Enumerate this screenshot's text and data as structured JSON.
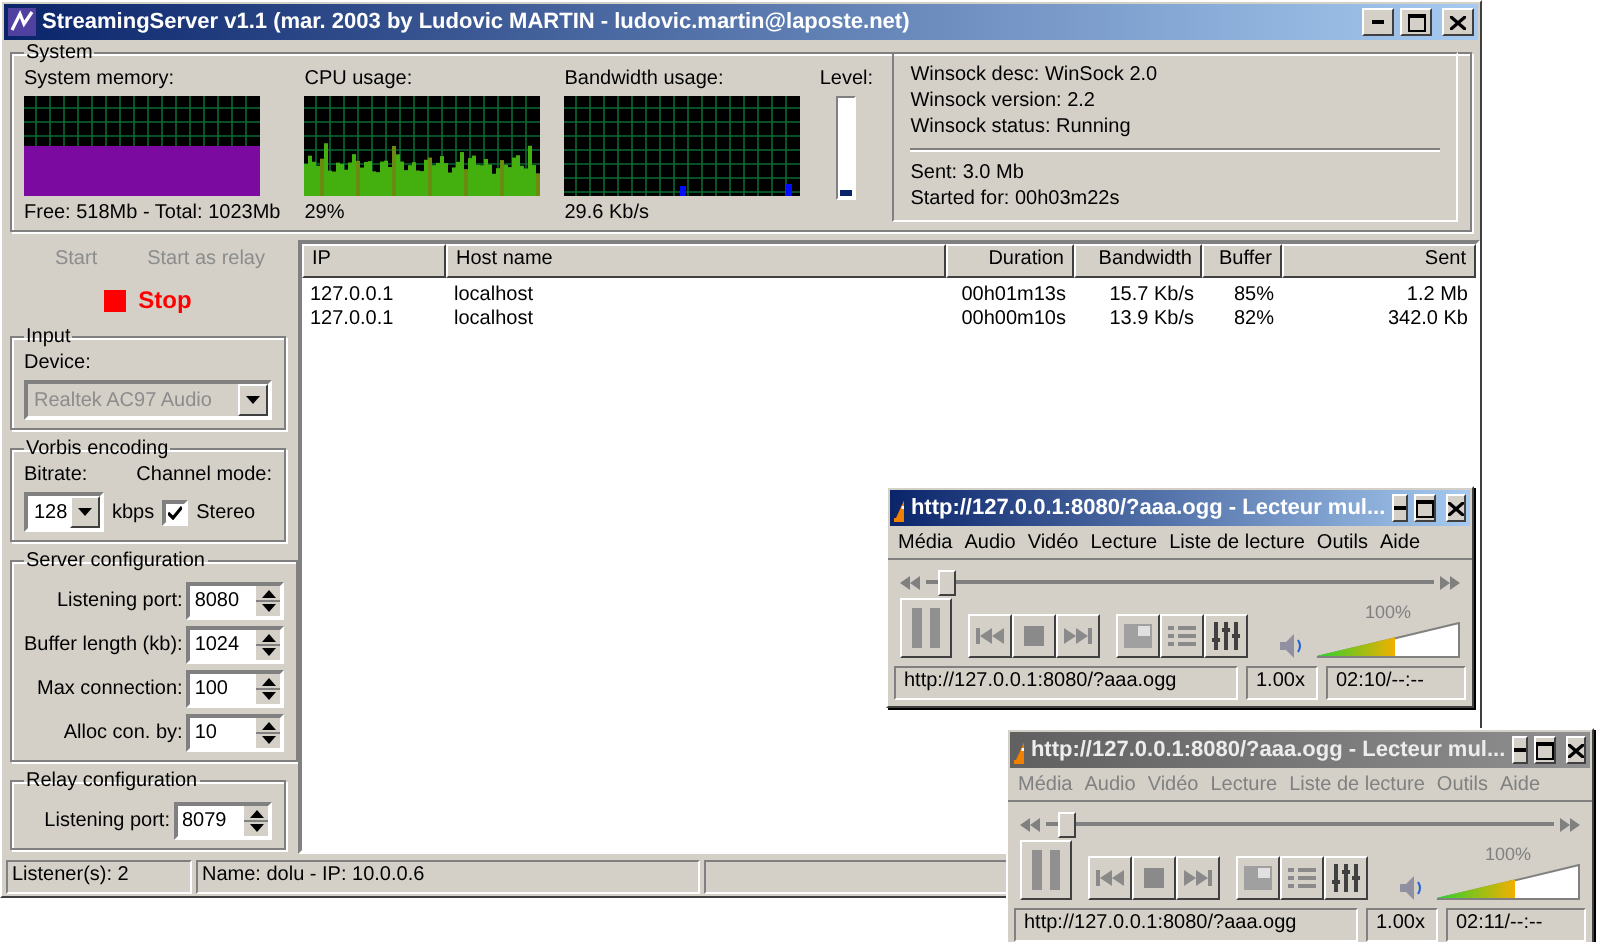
{
  "window": {
    "title": "StreamingServer v1.1 (mar. 2003 by Ludovic MARTIN - ludovic.martin@laposte.net)"
  },
  "system": {
    "title": "System",
    "graphs": [
      {
        "kind": "memory",
        "label": "System memory:",
        "reading": "Free: 518Mb - Total: 1023Mb"
      },
      {
        "kind": "cpu",
        "label": "CPU usage:",
        "reading": "29%"
      },
      {
        "kind": "bandwidth",
        "label": "Bandwidth usage:",
        "reading": "29.6 Kb/s"
      }
    ],
    "meter": {
      "label": "Level:",
      "level": 0.05
    },
    "info": [
      "Winsock desc: WinSock 2.0",
      "Winsock version: 2.2",
      "Winsock status: Running"
    ],
    "stats": [
      "Sent: 3.0 Mb",
      "Started for: 00h03m22s"
    ]
  },
  "start_buttons": [
    {
      "label": "Start",
      "disabled": true
    },
    {
      "label": "Start as relay",
      "disabled": true
    }
  ],
  "stop": {
    "label": "Stop",
    "disabled": false
  },
  "input": {
    "title": "Input",
    "device_label": "Device:",
    "device": "Realtek AC97 Audio",
    "disabled": true
  },
  "encoding": {
    "title": "Vorbis encoding",
    "bitrate_label": "Bitrate:",
    "bitrate": "128",
    "unit": "kbps",
    "channel_label": "Channel mode:",
    "stereo": {
      "label": "Stereo",
      "checked": true
    }
  },
  "server": {
    "title": "Server configuration",
    "fields": [
      {
        "label": "Listening port:",
        "value": "8080"
      },
      {
        "label": "Buffer length (kb):",
        "value": "1024"
      },
      {
        "label": "Max connection:",
        "value": "100"
      },
      {
        "label": "Alloc con. by:",
        "value": "10"
      }
    ]
  },
  "relay": {
    "title": "Relay configuration",
    "fields": [
      {
        "label": "Listening port:",
        "value": "8079"
      }
    ]
  },
  "table": {
    "columns": [
      "IP",
      "Host name",
      "Duration",
      "Bandwidth",
      "Buffer",
      "Sent"
    ],
    "rows": [
      [
        "127.0.0.1",
        "localhost",
        "00h01m13s",
        "15.7 Kb/s",
        "85%",
        "1.2 Mb"
      ],
      [
        "127.0.0.1",
        "localhost",
        "00h00m10s",
        "13.9 Kb/s",
        "82%",
        "342.0 Kb"
      ]
    ]
  },
  "status_bar": [
    "Listener(s): 2",
    "Name: dolu - IP: 10.0.0.6"
  ],
  "players": [
    {
      "title": "http://127.0.0.1:8080/?aaa.ogg - Lecteur mul...",
      "active": true,
      "menu": [
        "Média",
        "Audio",
        "Vidéo",
        "Lecture",
        "Liste de lecture",
        "Outils",
        "Aide"
      ],
      "seek": {
        "level": 0.03
      },
      "volume": {
        "label": "100%",
        "level": 0.55
      },
      "url": "http://127.0.0.1:8080/?aaa.ogg",
      "speed": "1.00x",
      "time": "02:10/--:--"
    },
    {
      "title": "http://127.0.0.1:8080/?aaa.ogg - Lecteur mul...",
      "active": false,
      "menu": [
        "Média",
        "Audio",
        "Vidéo",
        "Lecture",
        "Liste de lecture",
        "Outils",
        "Aide"
      ],
      "seek": {
        "level": 0.03
      },
      "volume": {
        "label": "100%",
        "level": 0.55
      },
      "url": "http://127.0.0.1:8080/?aaa.ogg",
      "speed": "1.00x",
      "time": "02:11/--:--"
    }
  ]
}
